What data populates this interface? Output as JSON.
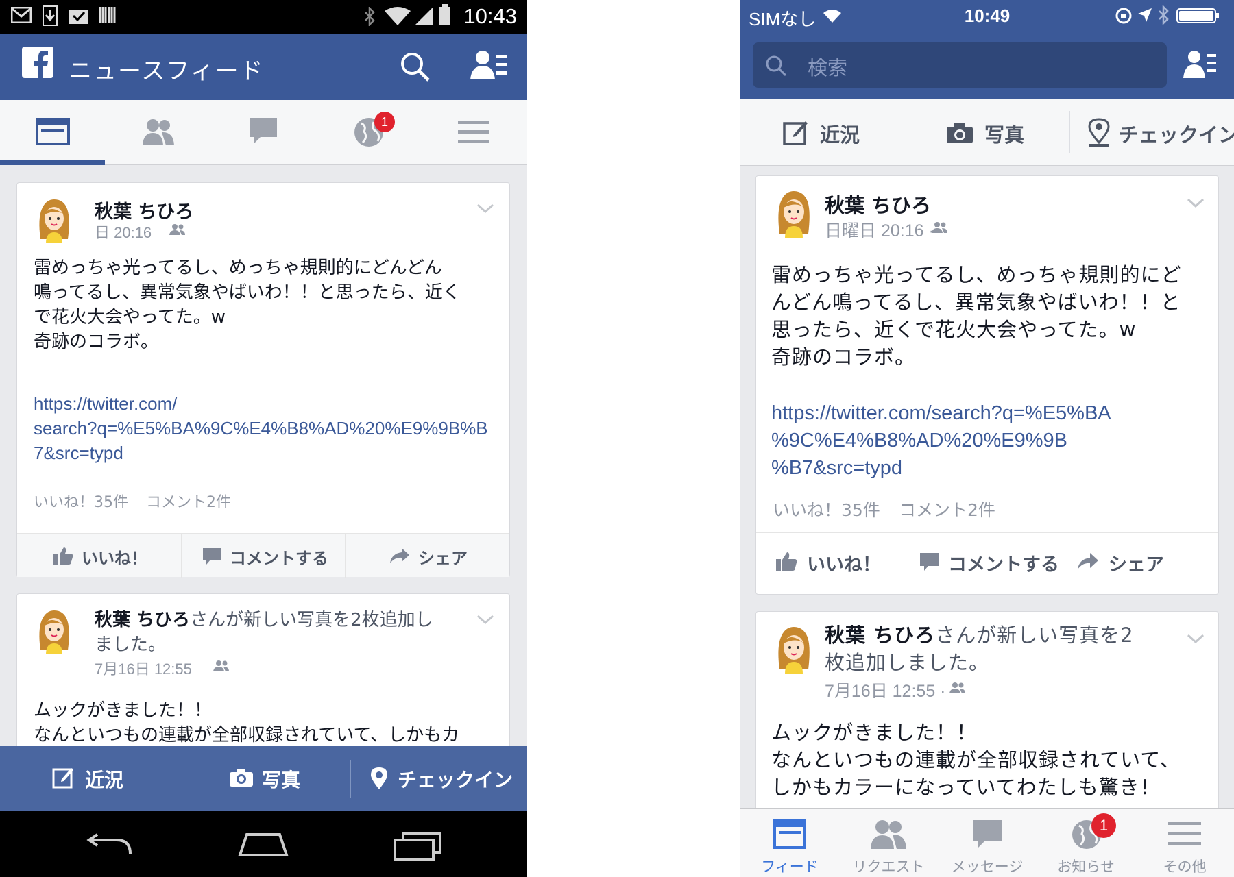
{
  "android": {
    "status_bar": {
      "time": "10:43"
    },
    "header": {
      "title": "ニュースフィード"
    },
    "post1": {
      "author": "秋葉 ちひろ",
      "meta": "日 20:16",
      "body": [
        "雷めっちゃ光ってるし、めっちゃ規則的にどんどん",
        "鳴ってるし、異常気象やばいわ！！と思ったら、近く",
        "で花火大会やってた。w",
        "奇跡のコラボ。"
      ],
      "link": [
        "https://twitter.com/",
        "search?q=%E5%BA%9C%E4%B8%AD%20%E9%9B%B",
        "7&src=typd"
      ],
      "likes": "いいね！35件",
      "comments": "コメント2件"
    },
    "actions": {
      "like": "いいね！",
      "comment": "コメントする",
      "share": "シェア"
    },
    "post2": {
      "author": "秋葉 ちひろ",
      "headline_rest": "さんが新しい写真を2枚追加し",
      "headline_line2": "ました。",
      "meta": "7月16日 12:55",
      "body": [
        "ムックがきました！！",
        "なんといつもの連載が全部収録されていて、しかもカ"
      ]
    },
    "bottom_bar": {
      "status": "近況",
      "photo": "写真",
      "checkin": "チェックイン"
    }
  },
  "ios": {
    "status_bar": {
      "carrier": "SIMなし",
      "time": "10:49"
    },
    "search": {
      "placeholder": "検索"
    },
    "composer": {
      "status": "近況",
      "photo": "写真",
      "checkin": "チェックイン"
    },
    "post1": {
      "author": "秋葉 ちひろ",
      "meta": "日曜日 20:16 ·",
      "body": [
        "雷めっちゃ光ってるし、めっちゃ規則的にど",
        "んどん鳴ってるし、異常気象やばいわ！！と",
        "思ったら、近くで花火大会やってた。w",
        "奇跡のコラボ。"
      ],
      "link": [
        "https://twitter.com/search?q=%E5%BA",
        "%9C%E4%B8%AD%20%E9%9B",
        "%B7&src=typd"
      ],
      "likes": "いいね！35件",
      "comments": "コメント2件"
    },
    "actions": {
      "like": "いいね！",
      "comment": "コメントする",
      "share": "シェア"
    },
    "post2": {
      "author": "秋葉 ちひろ",
      "headline_rest": "さんが新しい写真を2",
      "headline_line2": "枚追加しました。",
      "meta": "7月16日 12:55 ·",
      "body": [
        "ムックがきました！！",
        "なんといつもの連載が全部収録されていて、",
        "しかもカラーになっていてわたしも驚き！"
      ]
    },
    "tabbar": [
      {
        "label": "フィード"
      },
      {
        "label": "リクエスト"
      },
      {
        "label": "メッセージ"
      },
      {
        "label": "お知らせ",
        "badge": "1"
      },
      {
        "label": "その他"
      }
    ]
  },
  "badges": {
    "notifications": "1"
  },
  "colors": {
    "brand": "#3b5998",
    "link": "#3b5998",
    "badge": "#e0222d",
    "active_tab": "#3b73d8"
  }
}
